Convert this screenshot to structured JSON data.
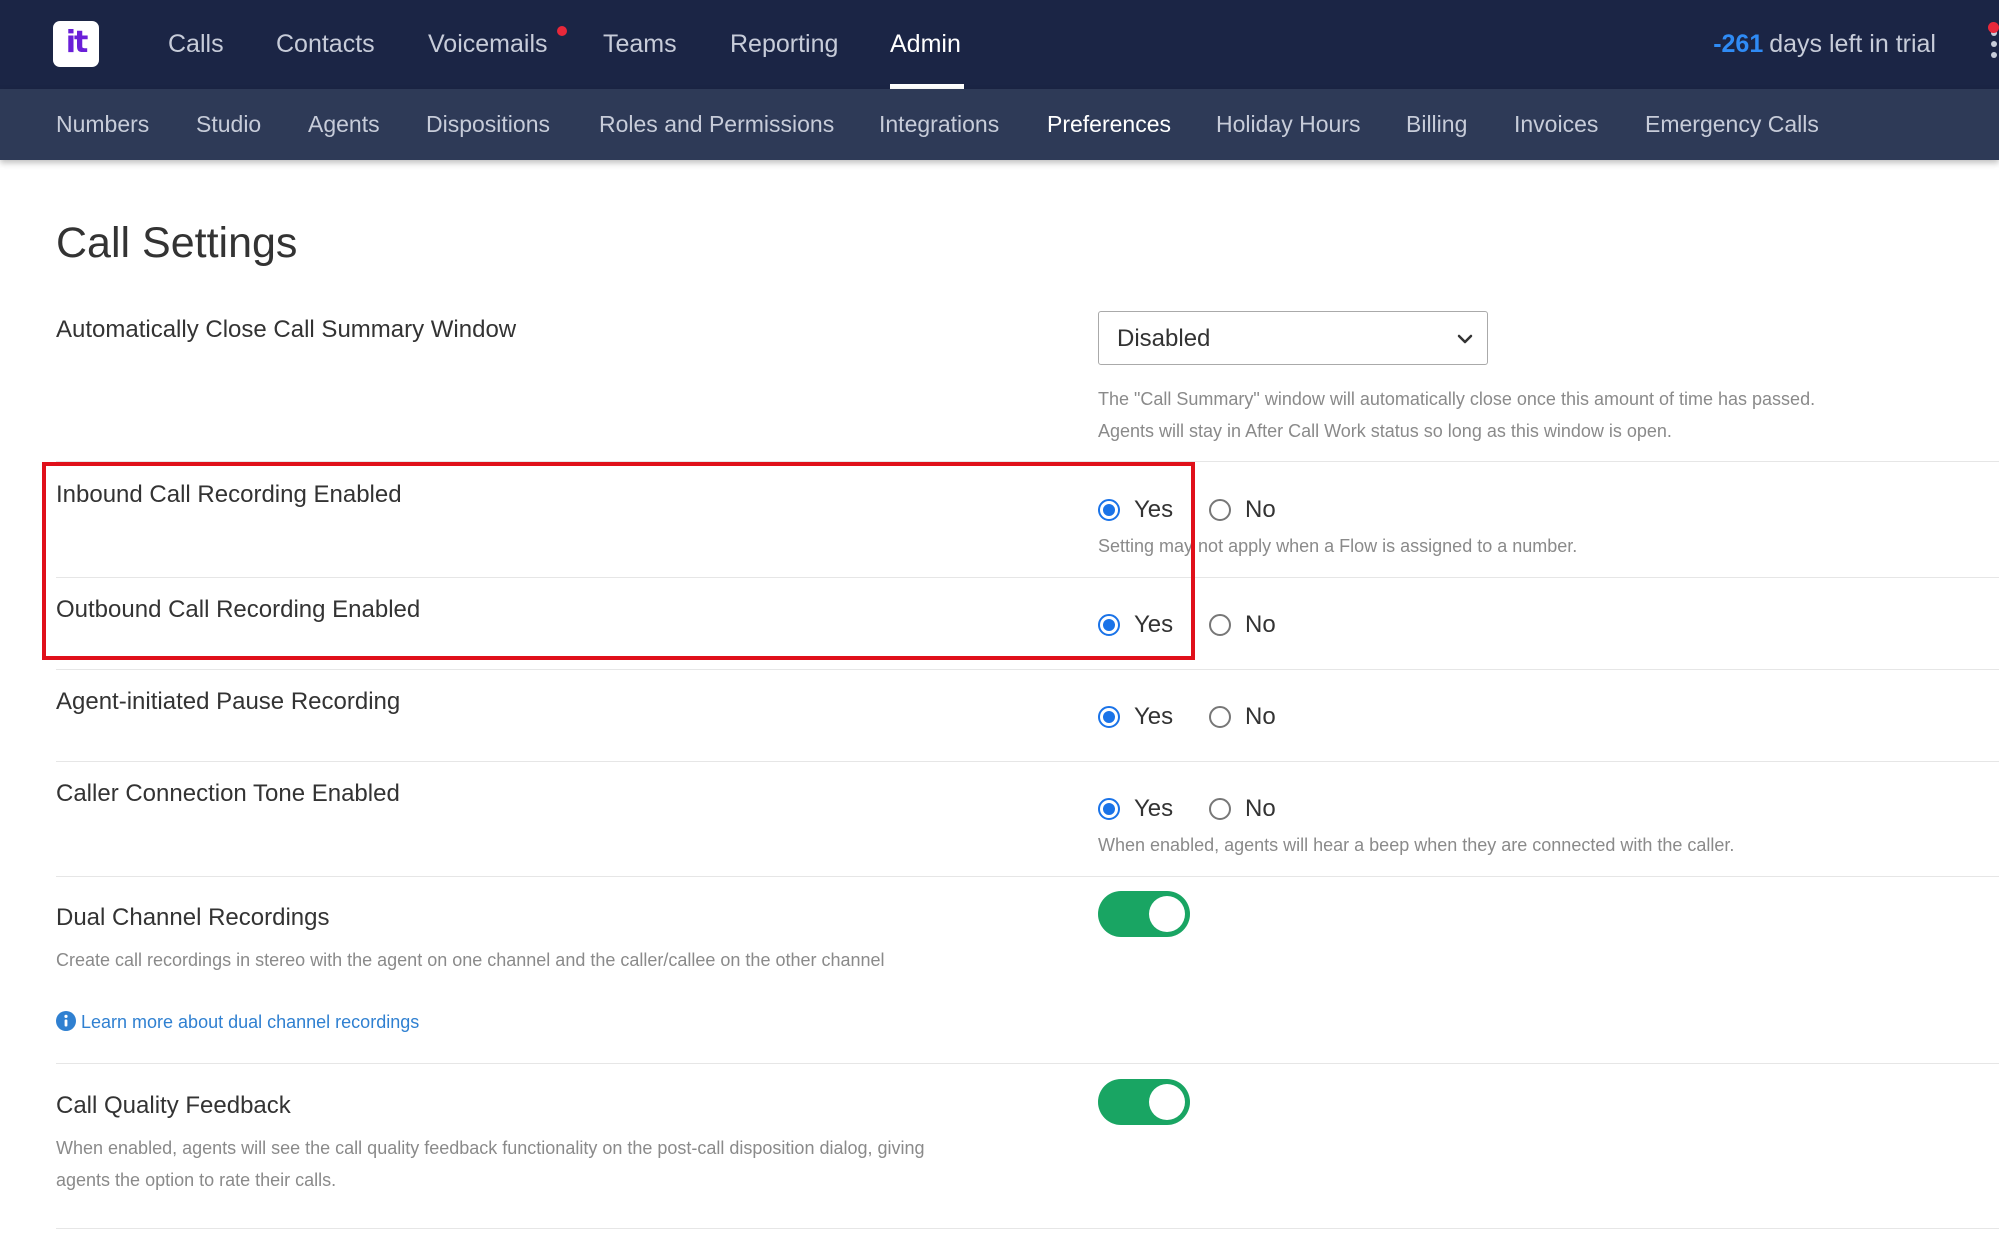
{
  "topnav": {
    "logo_text": "it",
    "items": [
      {
        "label": "Calls"
      },
      {
        "label": "Contacts"
      },
      {
        "label": "Voicemails"
      },
      {
        "label": "Teams"
      },
      {
        "label": "Reporting"
      },
      {
        "label": "Admin"
      }
    ],
    "active_item": "Admin",
    "notification_on": "Voicemails",
    "trial": {
      "days": "-261",
      "label": "days left in trial"
    }
  },
  "subnav": {
    "items": [
      {
        "label": "Numbers"
      },
      {
        "label": "Studio"
      },
      {
        "label": "Agents"
      },
      {
        "label": "Dispositions"
      },
      {
        "label": "Roles and Permissions"
      },
      {
        "label": "Integrations"
      },
      {
        "label": "Preferences"
      },
      {
        "label": "Holiday Hours"
      },
      {
        "label": "Billing"
      },
      {
        "label": "Invoices"
      },
      {
        "label": "Emergency Calls"
      }
    ],
    "active_item": "Preferences"
  },
  "page": {
    "title": "Call Settings",
    "settings": {
      "auto_close": {
        "label": "Automatically Close Call Summary Window",
        "selected": "Disabled",
        "help_line1": "The \"Call Summary\" window will automatically close once this amount of time has passed.",
        "help_line2": "Agents will stay in After Call Work status so long as this window is open."
      },
      "inbound_recording": {
        "label": "Inbound Call Recording Enabled",
        "yes": "Yes",
        "no": "No",
        "value": "Yes",
        "help": "Setting may not apply when a Flow is assigned to a number."
      },
      "outbound_recording": {
        "label": "Outbound Call Recording Enabled",
        "yes": "Yes",
        "no": "No",
        "value": "Yes"
      },
      "pause_recording": {
        "label": "Agent-initiated Pause Recording",
        "yes": "Yes",
        "no": "No",
        "value": "Yes"
      },
      "connection_tone": {
        "label": "Caller Connection Tone Enabled",
        "yes": "Yes",
        "no": "No",
        "value": "Yes",
        "help": "When enabled, agents will hear a beep when they are connected with the caller."
      },
      "dual_channel": {
        "label": "Dual Channel Recordings",
        "description": "Create call recordings in stereo with the agent on one channel and the caller/callee on the other channel",
        "link": "Learn more about dual channel recordings",
        "enabled": true
      },
      "quality_feedback": {
        "label": "Call Quality Feedback",
        "description_line1": "When enabled, agents will see the call quality feedback functionality on the post-call disposition dialog, giving",
        "description_line2": "agents the option to rate their calls.",
        "enabled": true
      }
    }
  },
  "colors": {
    "topnav_bg": "#1b2545",
    "subnav_bg": "#2e3a57",
    "accent_blue": "#1a73e8",
    "toggle_green": "#19a563",
    "highlight_red": "#e0101a",
    "notification_red": "#e8283a"
  }
}
